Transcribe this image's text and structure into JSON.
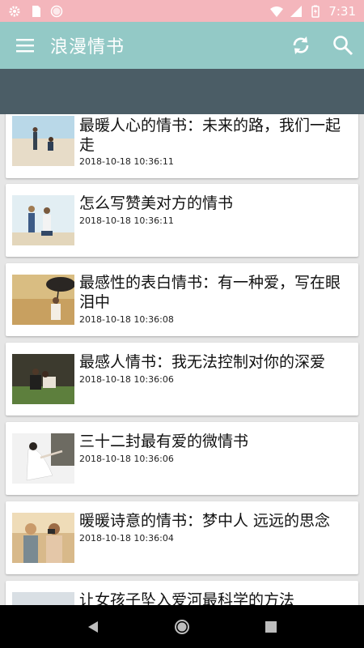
{
  "statusbar": {
    "time": "7:31"
  },
  "appbar": {
    "title": "浪漫情书"
  },
  "articles": [
    {
      "title": "最暖人心的情书：未来的路，我们一起走",
      "date": "2018-10-18 10:36:11"
    },
    {
      "title": "怎么写赞美对方的情书",
      "date": "2018-10-18 10:36:11"
    },
    {
      "title": "最感性的表白情书：有一种爱，写在眼泪中",
      "date": "2018-10-18 10:36:08"
    },
    {
      "title": "最感人情书：我无法控制对你的深爱",
      "date": "2018-10-18 10:36:06"
    },
    {
      "title": "三十二封最有爱的微情书",
      "date": "2018-10-18 10:36:06"
    },
    {
      "title": "暖暖诗意的情书：梦中人 远远的思念",
      "date": "2018-10-18 10:36:04"
    },
    {
      "title": "让女孩子坠入爱河最科学的方法",
      "date": ""
    }
  ]
}
